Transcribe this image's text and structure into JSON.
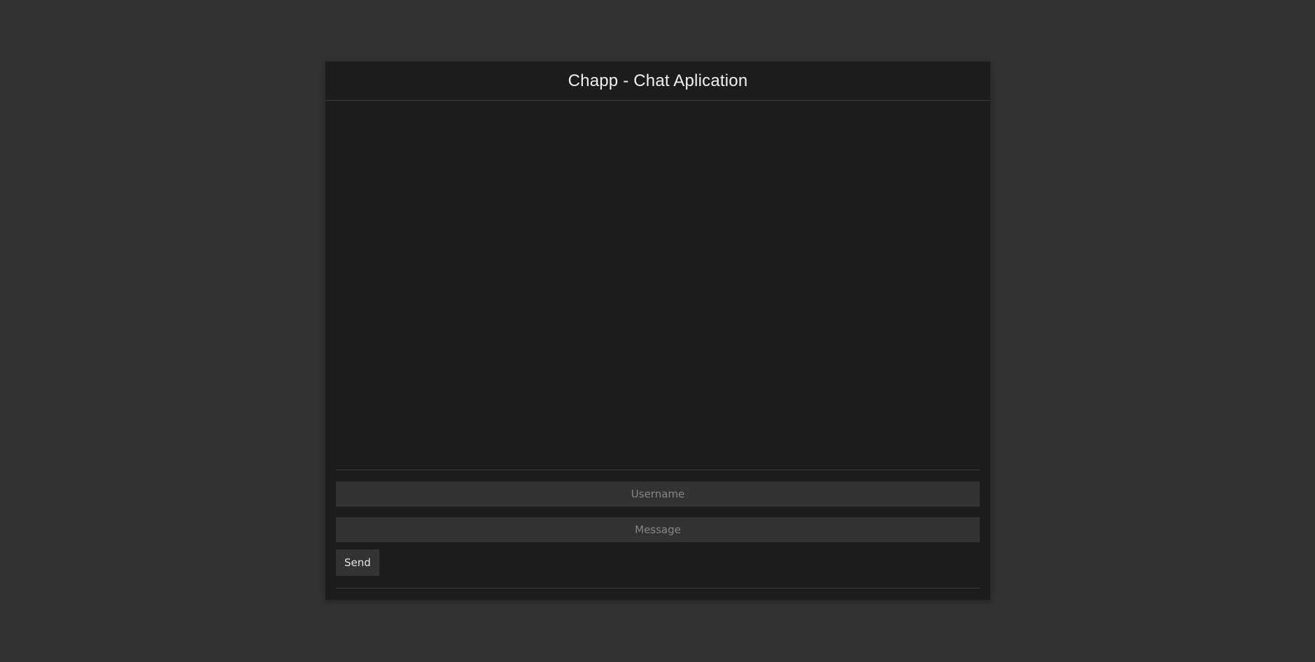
{
  "header": {
    "title": "Chapp - Chat Aplication"
  },
  "messages": [],
  "composer": {
    "username_placeholder": "Username",
    "username_value": "",
    "message_placeholder": "Message",
    "message_value": "",
    "send_label": "Send"
  },
  "colors": {
    "page_background": "#323232",
    "panel_background": "#1c1c1c",
    "input_background": "#333333",
    "title_text": "#f2f2f2",
    "placeholder_text": "#868686"
  }
}
